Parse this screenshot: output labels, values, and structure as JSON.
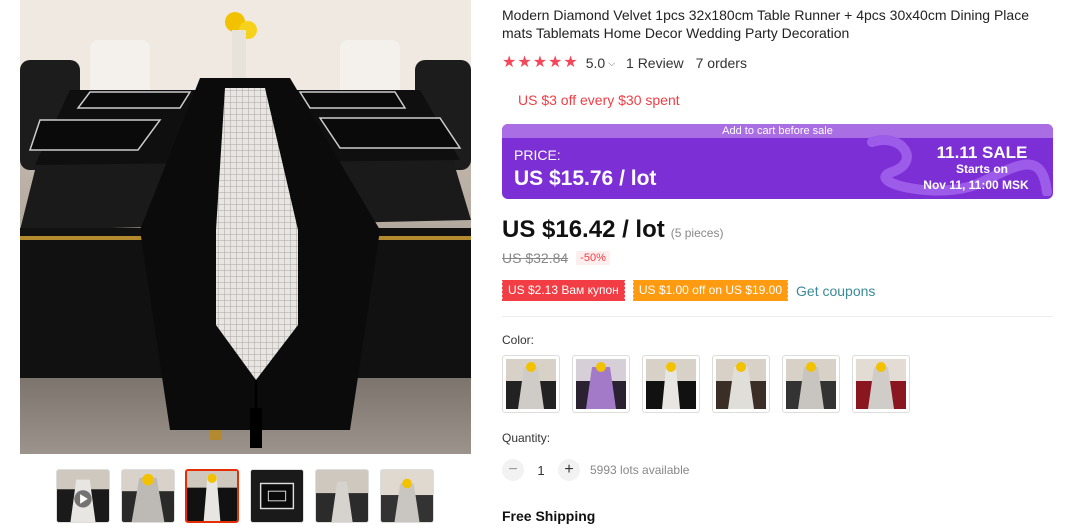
{
  "product": {
    "title": "Modern Diamond Velvet 1pcs 32x180cm Table Runner + 4pcs 30x40cm Dining Place mats Tablemats Home Decor Wedding Party Decoration",
    "rating": "5.0",
    "reviews": "1 Review",
    "orders": "7 orders",
    "store_discount": "US $3 off every $30 spent"
  },
  "promo": {
    "strip": "Add to cart before sale",
    "price_label": "PRICE:",
    "price": "US $15.76 / lot",
    "sale": "11.11 SALE",
    "starts": "Starts on",
    "date": "Nov 11, 11:00 MSK"
  },
  "price": {
    "current": "US $16.42 / lot",
    "pieces": "(5 pieces)",
    "original": "US $32.84",
    "discount": "-50%"
  },
  "coupons": {
    "red": "US $2.13 Вам купон",
    "orange": "US $1.00 off on US $19.00",
    "link": "Get coupons"
  },
  "color": {
    "label": "Color:"
  },
  "quantity": {
    "label": "Quantity:",
    "minus": "−",
    "value": "1",
    "plus": "+",
    "available": "5993 lots available"
  },
  "shipping": {
    "label": "Free Shipping"
  },
  "colors": {
    "accent": "#f23d44",
    "promo_bg": "#7d2fd6",
    "coupon_orange": "#ff9b10",
    "link": "#3a8a9a"
  }
}
